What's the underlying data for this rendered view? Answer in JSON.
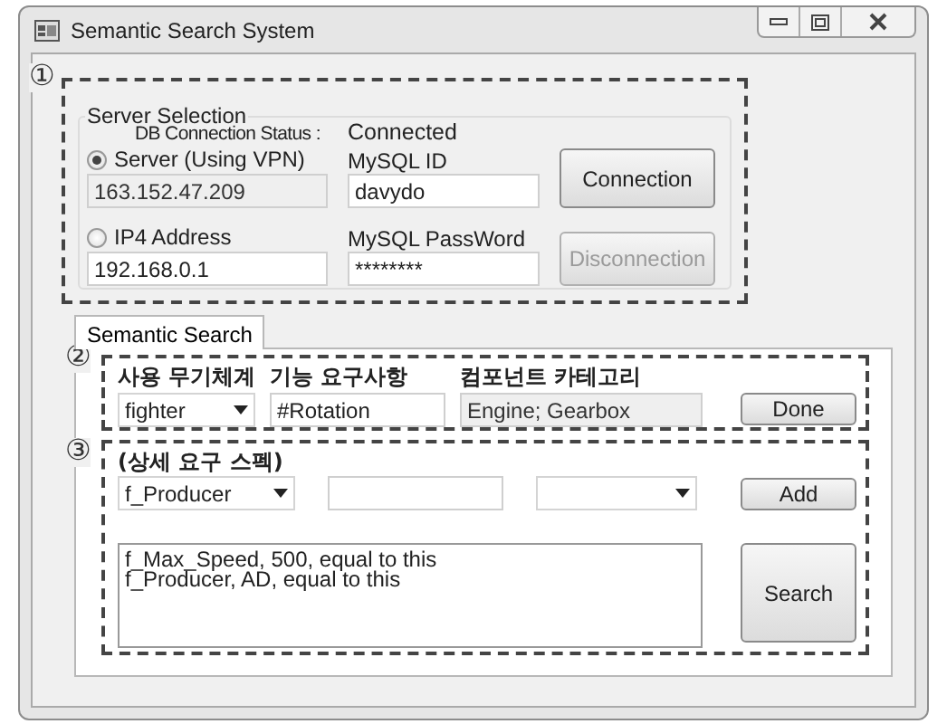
{
  "window": {
    "title": "Semantic Search System"
  },
  "server_selection": {
    "marker": "①",
    "title": "Server Selection",
    "status_label": "DB Connection Status :",
    "status_value": "Connected",
    "options": [
      {
        "label": "Server (Using VPN)",
        "selected": true,
        "address": "163.152.47.209",
        "address_disabled": true
      },
      {
        "label": "IP4 Address",
        "selected": false,
        "address": "192.168.0.1",
        "address_disabled": false
      }
    ],
    "mysql_id": {
      "label": "MySQL ID",
      "value": "davydo"
    },
    "mysql_password": {
      "label": "MySQL PassWord",
      "value": "********"
    },
    "buttons": [
      {
        "label": "Connection",
        "disabled": false
      },
      {
        "label": "Disconnection",
        "disabled": true
      }
    ]
  },
  "tabs": [
    {
      "label": "Semantic Search",
      "selected": true
    }
  ],
  "requirements": {
    "marker": "②",
    "columns": [
      "사용 무기체계",
      "기능 요구사항",
      "컴포넌트 카테고리"
    ],
    "weapon_system": {
      "value": "fighter"
    },
    "function": {
      "value": "#Rotation"
    },
    "component": {
      "value": "Engine; Gearbox",
      "disabled": true
    },
    "done_button": {
      "label": "Done"
    }
  },
  "detail_spec": {
    "marker": "③",
    "title": "(상세 요구 스펙)",
    "attribute": {
      "value": "f_Producer"
    },
    "add_button": {
      "label": "Add"
    },
    "conditions": [
      "f_Max_Speed, 500, equal to this",
      "f_Producer, AD, equal to this"
    ],
    "search_button": {
      "label": "Search"
    }
  }
}
